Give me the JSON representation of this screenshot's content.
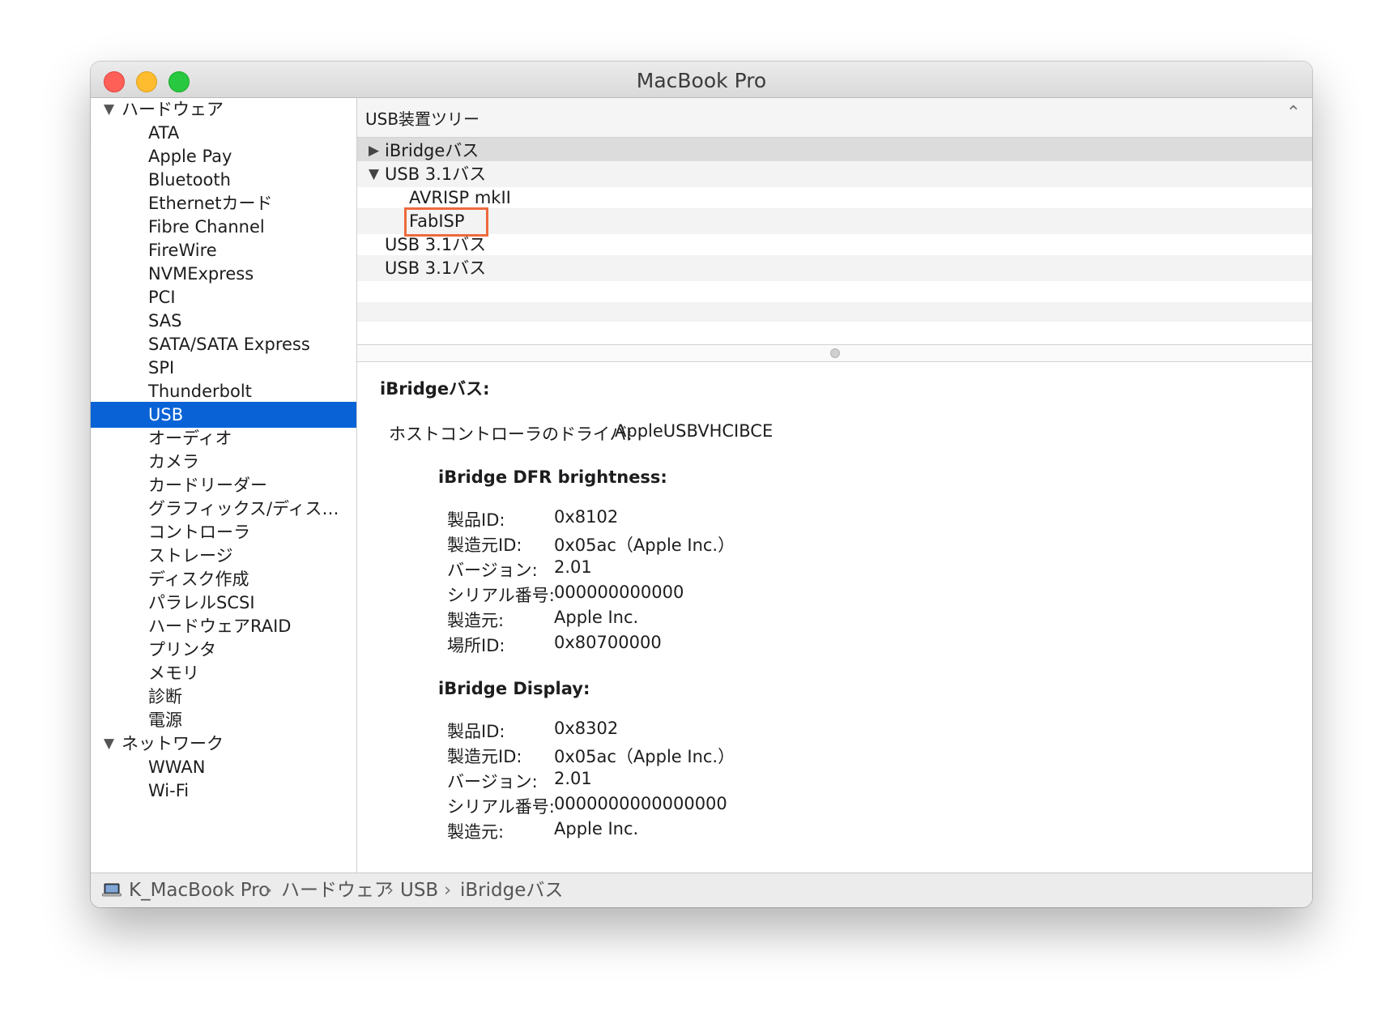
{
  "window": {
    "title": "MacBook Pro"
  },
  "sidebar": {
    "rows": [
      {
        "type": "cat",
        "label": "ハードウェア",
        "expanded": true
      },
      {
        "type": "item",
        "label": "ATA"
      },
      {
        "type": "item",
        "label": "Apple Pay"
      },
      {
        "type": "item",
        "label": "Bluetooth"
      },
      {
        "type": "item",
        "label": "Ethernetカード"
      },
      {
        "type": "item",
        "label": "Fibre Channel"
      },
      {
        "type": "item",
        "label": "FireWire"
      },
      {
        "type": "item",
        "label": "NVMExpress"
      },
      {
        "type": "item",
        "label": "PCI"
      },
      {
        "type": "item",
        "label": "SAS"
      },
      {
        "type": "item",
        "label": "SATA/SATA Express"
      },
      {
        "type": "item",
        "label": "SPI"
      },
      {
        "type": "item",
        "label": "Thunderbolt"
      },
      {
        "type": "item",
        "label": "USB",
        "selected": true
      },
      {
        "type": "item",
        "label": "オーディオ"
      },
      {
        "type": "item",
        "label": "カメラ"
      },
      {
        "type": "item",
        "label": "カードリーダー"
      },
      {
        "type": "item",
        "label": "グラフィックス/ディス…"
      },
      {
        "type": "item",
        "label": "コントローラ"
      },
      {
        "type": "item",
        "label": "ストレージ"
      },
      {
        "type": "item",
        "label": "ディスク作成"
      },
      {
        "type": "item",
        "label": "パラレルSCSI"
      },
      {
        "type": "item",
        "label": "ハードウェアRAID"
      },
      {
        "type": "item",
        "label": "プリンタ"
      },
      {
        "type": "item",
        "label": "メモリ"
      },
      {
        "type": "item",
        "label": "診断"
      },
      {
        "type": "item",
        "label": "電源"
      },
      {
        "type": "cat",
        "label": "ネットワーク",
        "expanded": true
      },
      {
        "type": "item",
        "label": "WWAN"
      },
      {
        "type": "item",
        "label": "Wi-Fi"
      }
    ]
  },
  "tree": {
    "header": "USB装置ツリー",
    "rows": [
      {
        "label": "iBridgeバス",
        "level": 0,
        "toggle": "collapsed",
        "selected": true
      },
      {
        "label": "USB 3.1バス",
        "level": 0,
        "toggle": "expanded"
      },
      {
        "label": "AVRISP mkII",
        "level": 1
      },
      {
        "label": "FabISP",
        "level": 1,
        "highlighted": true
      },
      {
        "label": "USB 3.1バス",
        "level": 0
      },
      {
        "label": "USB 3.1バス",
        "level": 0
      }
    ]
  },
  "detail": {
    "title": "iBridgeバス:",
    "driver_key": "ホストコントローラのドライバ:",
    "driver_value": "AppleUSBVHCIBCE",
    "devices": [
      {
        "name": "iBridge DFR brightness:",
        "props": [
          {
            "k": "製品ID:",
            "v": "0x8102"
          },
          {
            "k": "製造元ID:",
            "v": "0x05ac（Apple Inc.）"
          },
          {
            "k": "バージョン:",
            "v": "2.01"
          },
          {
            "k": "シリアル番号:",
            "v": "000000000000"
          },
          {
            "k": "製造元:",
            "v": "Apple Inc."
          },
          {
            "k": "場所ID:",
            "v": "0x80700000"
          }
        ]
      },
      {
        "name": "iBridge Display:",
        "props": [
          {
            "k": "製品ID:",
            "v": "0x8302"
          },
          {
            "k": "製造元ID:",
            "v": "0x05ac（Apple Inc.）"
          },
          {
            "k": "バージョン:",
            "v": "2.01"
          },
          {
            "k": "シリアル番号:",
            "v": "0000000000000000"
          },
          {
            "k": "製造元:",
            "v": "Apple Inc."
          }
        ]
      }
    ]
  },
  "statusbar": {
    "icon": "laptop-icon",
    "crumbs": [
      "K_MacBook Pro",
      "ハードウェア",
      "USB",
      "iBridgeバス"
    ],
    "separator": "›"
  }
}
